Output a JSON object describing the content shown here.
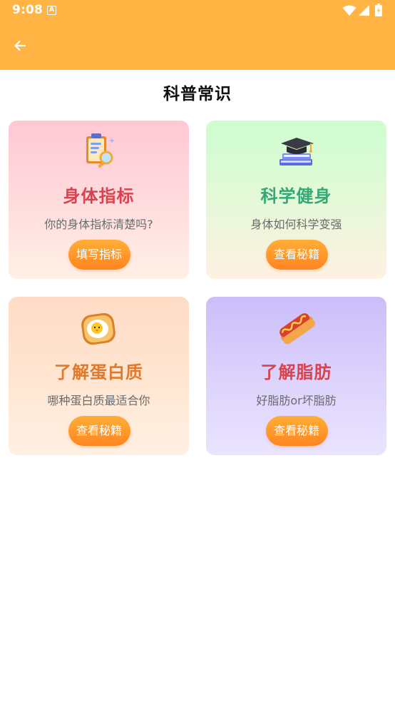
{
  "status_bar": {
    "time": "9:08",
    "notification_icon": "A"
  },
  "app_bar": {
    "back_icon": "arrow-left-icon"
  },
  "page": {
    "title": "科普常识"
  },
  "cards": [
    {
      "title": "身体指标",
      "subtitle": "你的身体指标清楚吗?",
      "button": "填写指标",
      "title_color": "#D9434F",
      "icon": "clipboard-magnifier-icon"
    },
    {
      "title": "科学健身",
      "subtitle": "身体如何科学变强",
      "button": "查看秘籍",
      "title_color": "#35A877",
      "icon": "graduation-books-icon"
    },
    {
      "title": "了解蛋白质",
      "subtitle": "哪种蛋白质最适合你",
      "button": "查看秘籍",
      "title_color": "#E0792A",
      "icon": "egg-toast-icon"
    },
    {
      "title": "了解脂肪",
      "subtitle": "好脂肪or坏脂肪",
      "button": "查看秘籍",
      "title_color": "#D9434F",
      "icon": "hotdog-icon"
    }
  ],
  "colors": {
    "header": "#FFB444",
    "button_top": "#FFAE37",
    "button_bottom": "#FF8520"
  }
}
